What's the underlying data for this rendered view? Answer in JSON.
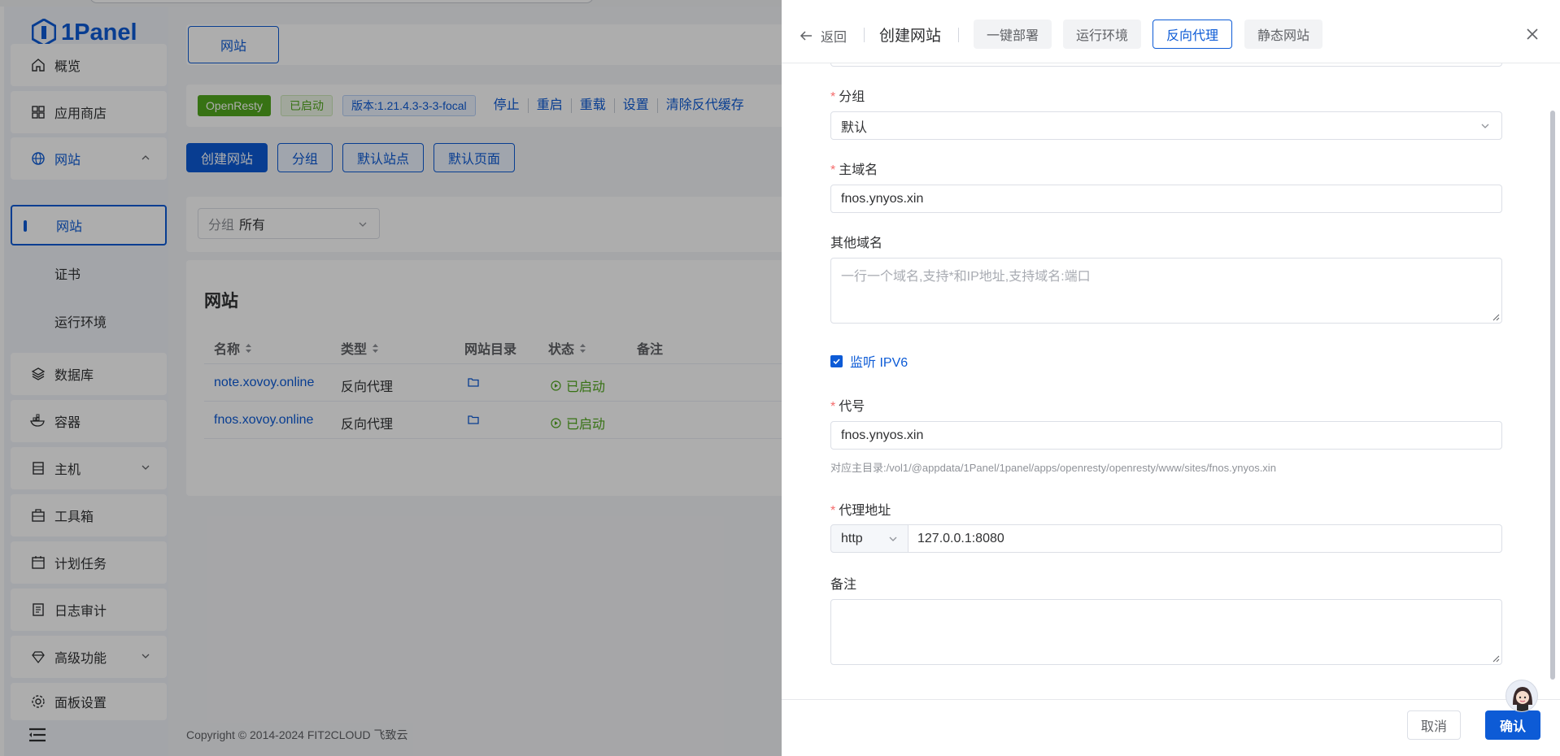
{
  "app": {
    "logo_text": "1Panel",
    "brand_color": "#0d5bd6"
  },
  "sidebar": {
    "items": [
      {
        "label": "概览",
        "icon": "home-icon"
      },
      {
        "label": "应用商店",
        "icon": "grid-icon"
      },
      {
        "label": "网站",
        "icon": "globe-icon",
        "expanded": true
      },
      {
        "label": "数据库",
        "icon": "layers-icon"
      },
      {
        "label": "容器",
        "icon": "docker-icon"
      },
      {
        "label": "主机",
        "icon": "server-icon"
      },
      {
        "label": "工具箱",
        "icon": "toolbox-icon"
      },
      {
        "label": "计划任务",
        "icon": "calendar-icon"
      },
      {
        "label": "日志审计",
        "icon": "log-icon"
      },
      {
        "label": "高级功能",
        "icon": "diamond-icon"
      },
      {
        "label": "面板设置",
        "icon": "gear-icon"
      }
    ],
    "subitems": [
      {
        "label": "网站",
        "active": true
      },
      {
        "label": "证书"
      },
      {
        "label": "运行环境"
      }
    ]
  },
  "main": {
    "tab_label": "网站",
    "status": {
      "app_tag": "OpenResty",
      "state_tag": "已启动",
      "version_tag": "版本:1.21.4.3-3-3-focal",
      "actions": [
        "停止",
        "重启",
        "重载",
        "设置",
        "清除反代缓存"
      ]
    },
    "buttons": [
      "创建网站",
      "分组",
      "默认站点",
      "默认页面"
    ],
    "group_filter": {
      "prefix": "分组",
      "value": "所有"
    },
    "table": {
      "title": "网站",
      "columns": [
        "名称",
        "类型",
        "网站目录",
        "状态",
        "备注"
      ],
      "rows": [
        {
          "name": "note.xovoy.online",
          "type": "反向代理",
          "status": "已启动"
        },
        {
          "name": "fnos.xovoy.online",
          "type": "反向代理",
          "status": "已启动"
        }
      ]
    },
    "copyright": "Copyright © 2014-2024 FIT2CLOUD 飞致云"
  },
  "drawer": {
    "back_label": "返回",
    "title": "创建网站",
    "tabs": [
      {
        "label": "一键部署",
        "active": false
      },
      {
        "label": "运行环境",
        "active": false
      },
      {
        "label": "反向代理",
        "active": true
      },
      {
        "label": "静态网站",
        "active": false
      }
    ],
    "form": {
      "group_label": "分组",
      "group_value": "默认",
      "primary_domain_label": "主域名",
      "primary_domain_value": "fnos.ynyos.xin",
      "other_domains_label": "其他域名",
      "other_domains_placeholder": "一行一个域名,支持*和IP地址,支持域名:端口",
      "ipv6_label": "监听 IPV6",
      "ipv6_checked": true,
      "alias_label": "代号",
      "alias_value": "fnos.ynyos.xin",
      "alias_hint": "对应主目录:/vol1/@appdata/1Panel/1panel/apps/openresty/openresty/www/sites/fnos.ynyos.xin",
      "proxy_label": "代理地址",
      "proxy_protocol": "http",
      "proxy_address": "127.0.0.1:8080",
      "remark_label": "备注"
    },
    "cancel_label": "取消",
    "confirm_label": "确认"
  }
}
